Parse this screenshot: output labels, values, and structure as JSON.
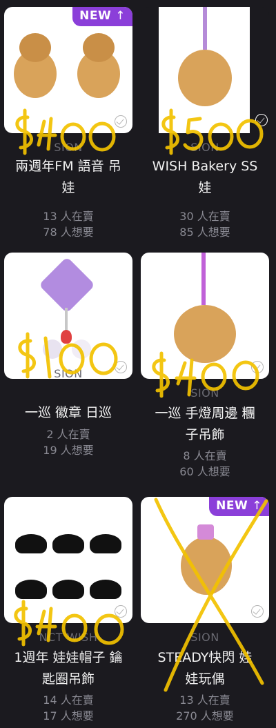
{
  "products": [
    {
      "badge": "NEW",
      "group": "SION",
      "title_lines": [
        "兩週年FM 語音 吊",
        "娃"
      ],
      "sellers": "13 人在賣",
      "wanted": "78 人想要",
      "handwritten_price": "$400"
    },
    {
      "group": "SION",
      "title_lines": [
        "WISH Bakery SS",
        "娃"
      ],
      "sellers": "30 人在賣",
      "wanted": "85 人想要",
      "handwritten_price": "$500"
    },
    {
      "group": "SION",
      "title_lines": [
        "一巡 徽章 日巡"
      ],
      "sellers": "2 人在賣",
      "wanted": "19 人想要",
      "handwritten_price": "$100"
    },
    {
      "group": "SION",
      "title_lines": [
        "一巡 手燈周邊 糰",
        "子吊飾"
      ],
      "sellers": "8 人在賣",
      "wanted": "60 人想要",
      "handwritten_price": "$400"
    },
    {
      "group": "NCT WISH",
      "title_lines": [
        "1週年 娃娃帽子 鑰",
        "匙圈吊飾"
      ],
      "sellers": "14 人在賣",
      "wanted": "17 人想要",
      "handwritten_price": "$400"
    },
    {
      "badge": "NEW",
      "group": "SION",
      "title_lines": [
        "STEADY快閃 娃",
        "娃玩偶"
      ],
      "sellers": "13 人在賣",
      "wanted": "270 人想要",
      "handwritten_price": ""
    }
  ],
  "colors": {
    "background": "#1b1a1f",
    "badge": "#8b3fd9",
    "scribble": "#f2c200",
    "plush": "#d9a35a"
  }
}
